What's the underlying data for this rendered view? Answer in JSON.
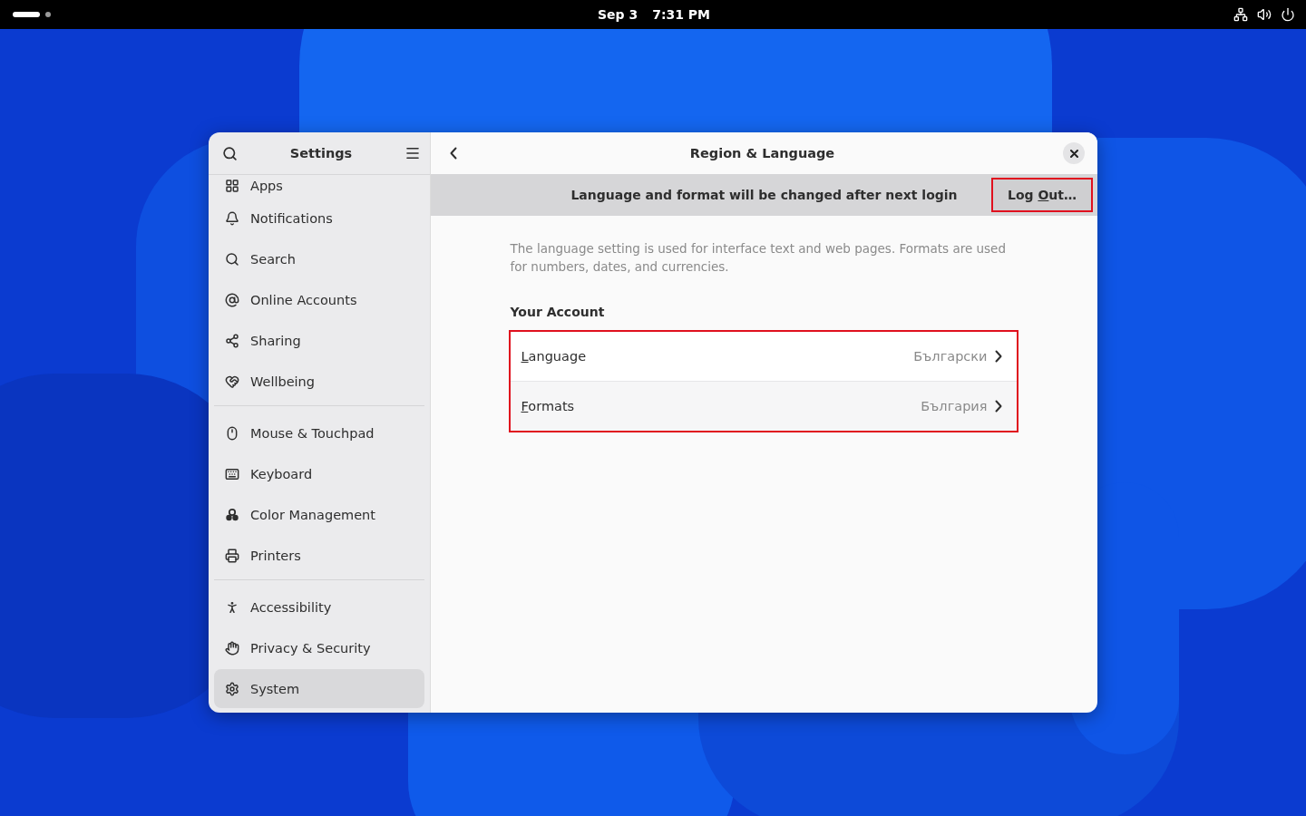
{
  "top_bar": {
    "date": "Sep 3",
    "time": "7:31 PM",
    "workspaces": [
      {
        "selected": true
      },
      {
        "selected": false
      }
    ]
  },
  "window": {
    "sidebar": {
      "title": "Settings",
      "sections": [
        [
          {
            "label": "Apps",
            "selected": false
          },
          {
            "label": "Notifications",
            "selected": false
          },
          {
            "label": "Search",
            "selected": false
          },
          {
            "label": "Online Accounts",
            "selected": false
          },
          {
            "label": "Sharing",
            "selected": false
          },
          {
            "label": "Wellbeing",
            "selected": false
          }
        ],
        [
          {
            "label": "Mouse & Touchpad",
            "selected": false
          },
          {
            "label": "Keyboard",
            "selected": false
          },
          {
            "label": "Color Management",
            "selected": false
          },
          {
            "label": "Printers",
            "selected": false
          }
        ],
        [
          {
            "label": "Accessibility",
            "selected": false
          },
          {
            "label": "Privacy & Security",
            "selected": false
          },
          {
            "label": "System",
            "selected": true
          }
        ]
      ]
    },
    "title": "Region & Language",
    "banner": {
      "message": "Language and format will be changed after next login",
      "button": {
        "label_parts": {
          "before": "Log ",
          "mnemonic": "O",
          "rest": "ut…"
        },
        "highlighted": true
      }
    },
    "description": "The language setting is used for interface text and web pages. Formats are used for numbers, dates, and currencies.",
    "section_title": "Your Account",
    "account_rows_highlighted": true,
    "account_rows": [
      {
        "label_parts": {
          "mnemonic": "L",
          "rest": "anguage"
        },
        "value": "Български"
      },
      {
        "label_parts": {
          "mnemonic": "F",
          "rest": "ormats"
        },
        "value": "България"
      }
    ]
  }
}
